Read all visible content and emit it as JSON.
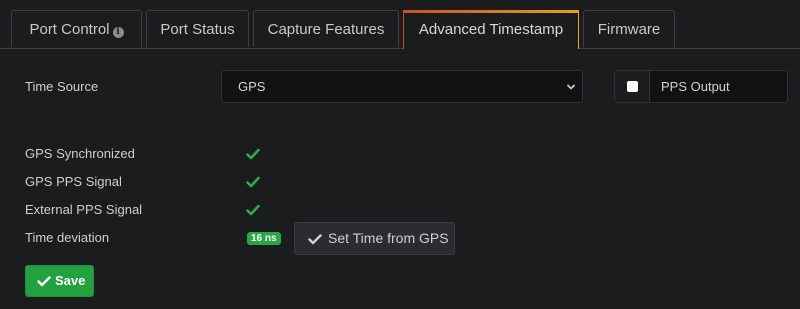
{
  "tabs": [
    {
      "label": "Port Control",
      "icon": "info-icon",
      "active": false
    },
    {
      "label": "Port Status",
      "active": false
    },
    {
      "label": "Capture Features",
      "active": false
    },
    {
      "label": "Advanced Timestamp",
      "active": true
    },
    {
      "label": "Firmware",
      "active": false
    }
  ],
  "form": {
    "time_source_label": "Time Source",
    "time_source_value": "GPS",
    "pps_output_label": "PPS Output",
    "pps_output_checked": false,
    "gps_synchronized_label": "GPS Synchronized",
    "gps_synchronized_ok": true,
    "gps_pps_signal_label": "GPS PPS Signal",
    "gps_pps_signal_ok": true,
    "external_pps_signal_label": "External PPS Signal",
    "external_pps_signal_ok": true,
    "time_deviation_label": "Time deviation",
    "time_deviation_value": "16 ns"
  },
  "buttons": {
    "set_time_label": "Set Time from GPS",
    "save_label": "Save"
  },
  "colors": {
    "background": "#1b1c1e",
    "accent_gradient_start": "#c8502e",
    "accent_gradient_end": "#e8a018",
    "success": "#27a845",
    "check": "#2eaa4c"
  }
}
